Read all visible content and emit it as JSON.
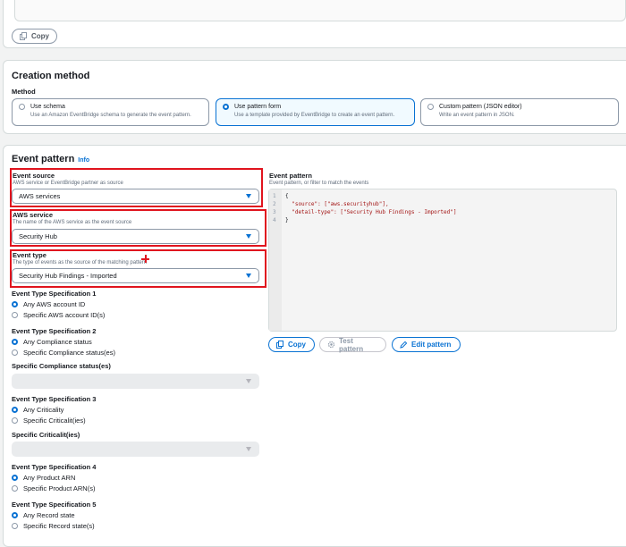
{
  "top": {
    "copy_label": "Copy"
  },
  "creation": {
    "title": "Creation method",
    "method_label": "Method",
    "options": [
      {
        "title": "Use schema",
        "desc": "Use an Amazon EventBridge schema to generate the event pattern.",
        "selected": false
      },
      {
        "title": "Use pattern form",
        "desc": "Use a template provided by EventBridge to create an event pattern.",
        "selected": true
      },
      {
        "title": "Custom pattern (JSON editor)",
        "desc": "Write an event pattern in JSON.",
        "selected": false
      }
    ]
  },
  "pattern": {
    "title": "Event pattern",
    "info": "Info",
    "event_source": {
      "label": "Event source",
      "desc": "AWS service or EventBridge partner as source",
      "value": "AWS services"
    },
    "aws_service": {
      "label": "AWS service",
      "desc": "The name of the AWS service as the event source",
      "value": "Security Hub"
    },
    "event_type": {
      "label": "Event type",
      "desc": "The type of events as the source of the matching pattern",
      "value": "Security Hub Findings - Imported"
    },
    "specs": [
      {
        "title": "Event Type Specification 1",
        "options": [
          "Any AWS account ID",
          "Specific AWS account ID(s)"
        ],
        "selected": 0
      },
      {
        "title": "Event Type Specification 2",
        "options": [
          "Any Compliance status",
          "Specific Compliance status(es)"
        ],
        "selected": 0,
        "field_label": "Specific Compliance status(es)"
      },
      {
        "title": "Event Type Specification 3",
        "options": [
          "Any Criticality",
          "Specific Criticalit(ies)"
        ],
        "selected": 0,
        "field_label": "Specific Criticalit(ies)"
      },
      {
        "title": "Event Type Specification 4",
        "options": [
          "Any Product ARN",
          "Specific Product ARN(s)"
        ],
        "selected": 0
      },
      {
        "title": "Event Type Specification 5",
        "options": [
          "Any Record state",
          "Specific Record state(s)"
        ],
        "selected": 0
      }
    ],
    "editor": {
      "label": "Event pattern",
      "desc": "Event pattern, or filter to match the events",
      "lines": [
        {
          "n": "1",
          "text": "{"
        },
        {
          "n": "2",
          "key": "  \"source\": ",
          "value": "[\"aws.securityhub\"],"
        },
        {
          "n": "3",
          "key": "  \"detail-type\": ",
          "value": "[\"Security Hub Findings - Imported\"]"
        },
        {
          "n": "4",
          "text": "}"
        }
      ],
      "copy_label": "Copy",
      "test_label": "Test pattern",
      "edit_label": "Edit pattern"
    }
  },
  "colors": {
    "accent": "#0972d3",
    "highlight": "#e0141e",
    "text": "#16191f",
    "muted": "#5f6b7a"
  }
}
